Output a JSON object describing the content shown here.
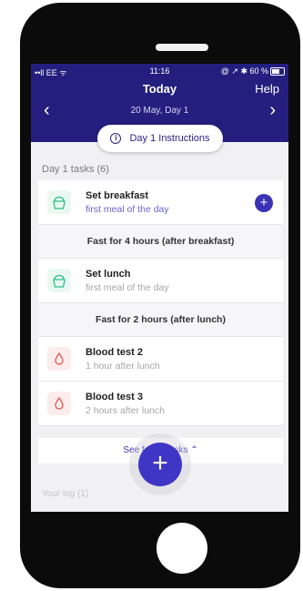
{
  "status_bar": {
    "carrier": "••ll EE ᯤ",
    "time": "11:16",
    "right": "@ ↗ ✱ 60 %"
  },
  "header": {
    "title": "Today",
    "help": "Help",
    "date": "20 May, Day 1",
    "prev_icon": "chevron-left-icon",
    "next_icon": "chevron-right-icon"
  },
  "instructions_button": {
    "label": "Day 1 Instructions",
    "icon": "info-icon"
  },
  "tasks_section": {
    "title": "Day 1 tasks (6)"
  },
  "tasks": [
    {
      "name": "Set breakfast",
      "sub": "first meal of the day",
      "icon": "meal-icon"
    },
    {
      "fast": "Fast for 4 hours (after breakfast)"
    },
    {
      "name": "Set lunch",
      "sub": "first meal of the day",
      "icon": "meal-icon"
    },
    {
      "fast": "Fast for 2 hours (after lunch)"
    },
    {
      "name": "Blood test 2",
      "sub": "1 hour after lunch",
      "icon": "blood-drop-icon"
    },
    {
      "name": "Blood test 3",
      "sub": "2 hours after lunch",
      "icon": "blood-drop-icon"
    }
  ],
  "see_fewer": {
    "label": "See fewer tasks ⌃"
  },
  "log_section": {
    "title": "Your log (1)"
  },
  "colors": {
    "header": "#241f7e",
    "accent": "#3f36c6",
    "meal": "#2fbf8a",
    "blood": "#e2534c"
  }
}
